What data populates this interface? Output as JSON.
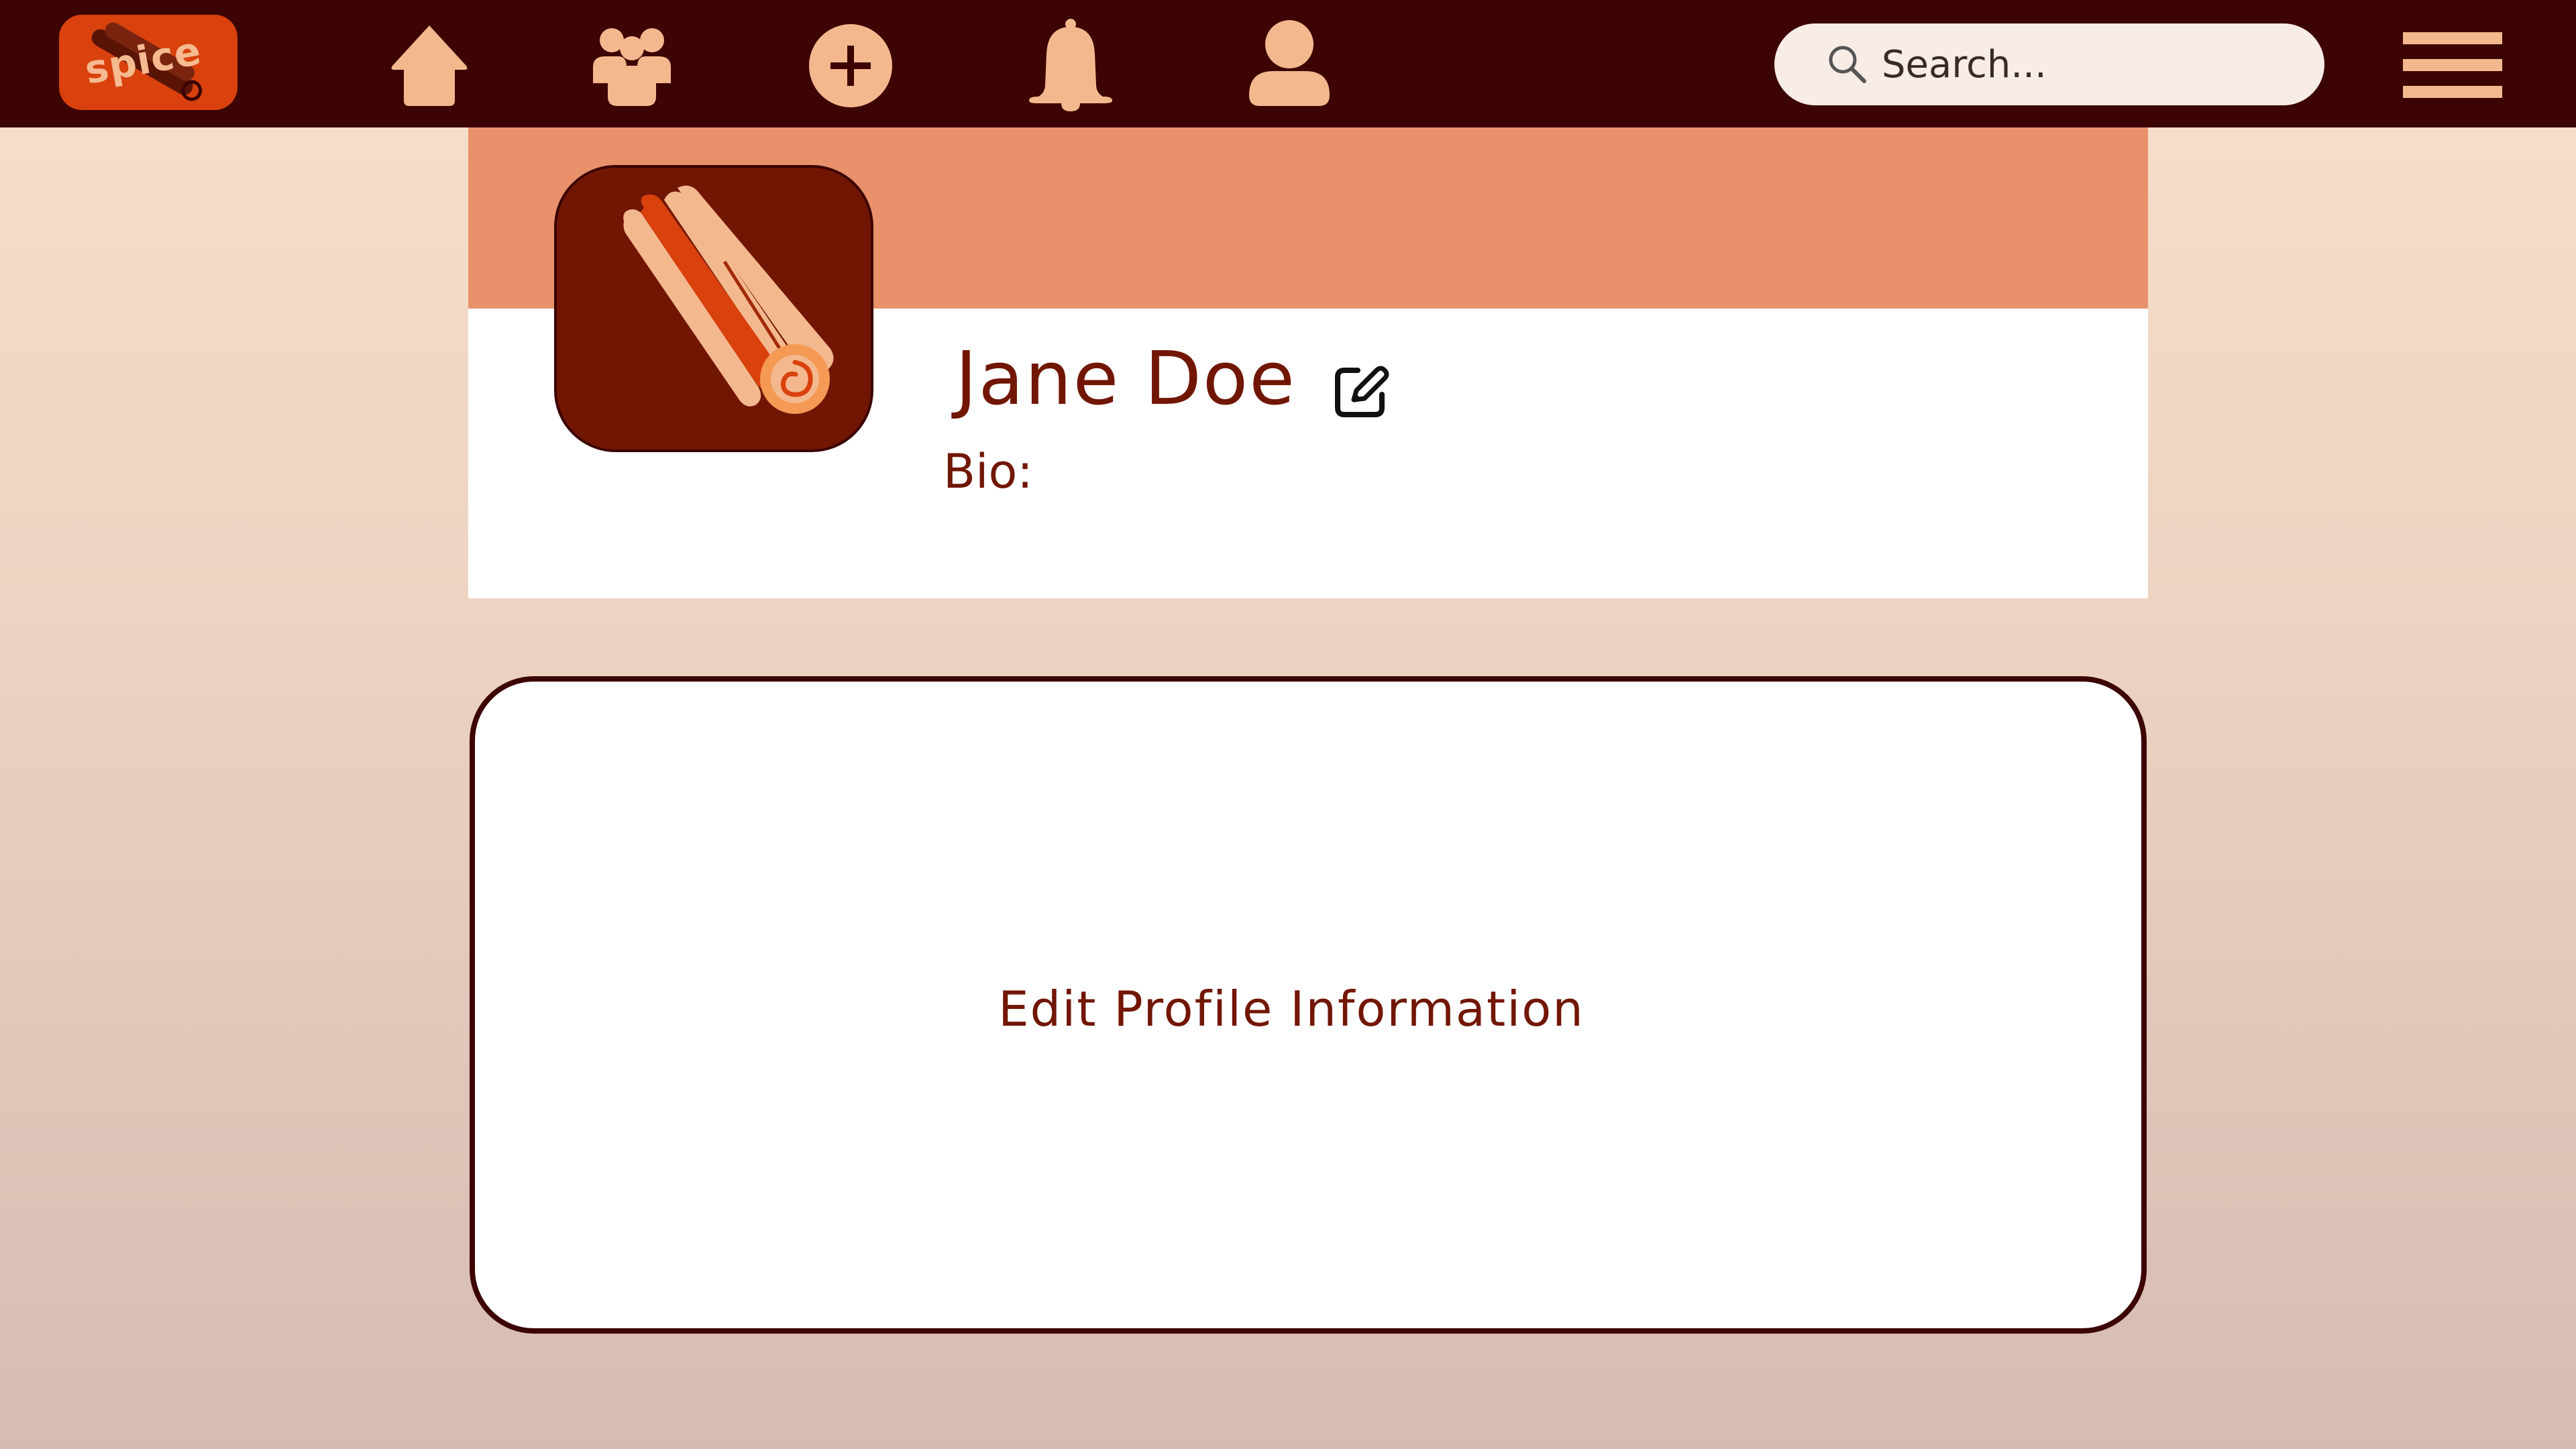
{
  "app": {
    "logo_text": "spice"
  },
  "nav": {
    "icons": [
      "home-icon",
      "groups-icon",
      "plus-circle-icon",
      "bell-icon",
      "user-icon",
      "menu-icon"
    ]
  },
  "search": {
    "placeholder": "Search..."
  },
  "profile": {
    "name": "Jane Doe",
    "bio_label": "Bio:",
    "bio": ""
  },
  "edit_profile": {
    "label": "Edit Profile Information"
  },
  "colors": {
    "navbar": "#3c0402",
    "nav_icon": "#f4b88e",
    "logo_bg": "#d9410d",
    "banner": "#e8916b",
    "avatar_bg": "#721604",
    "text_primary": "#721604",
    "border": "#3c0402"
  }
}
